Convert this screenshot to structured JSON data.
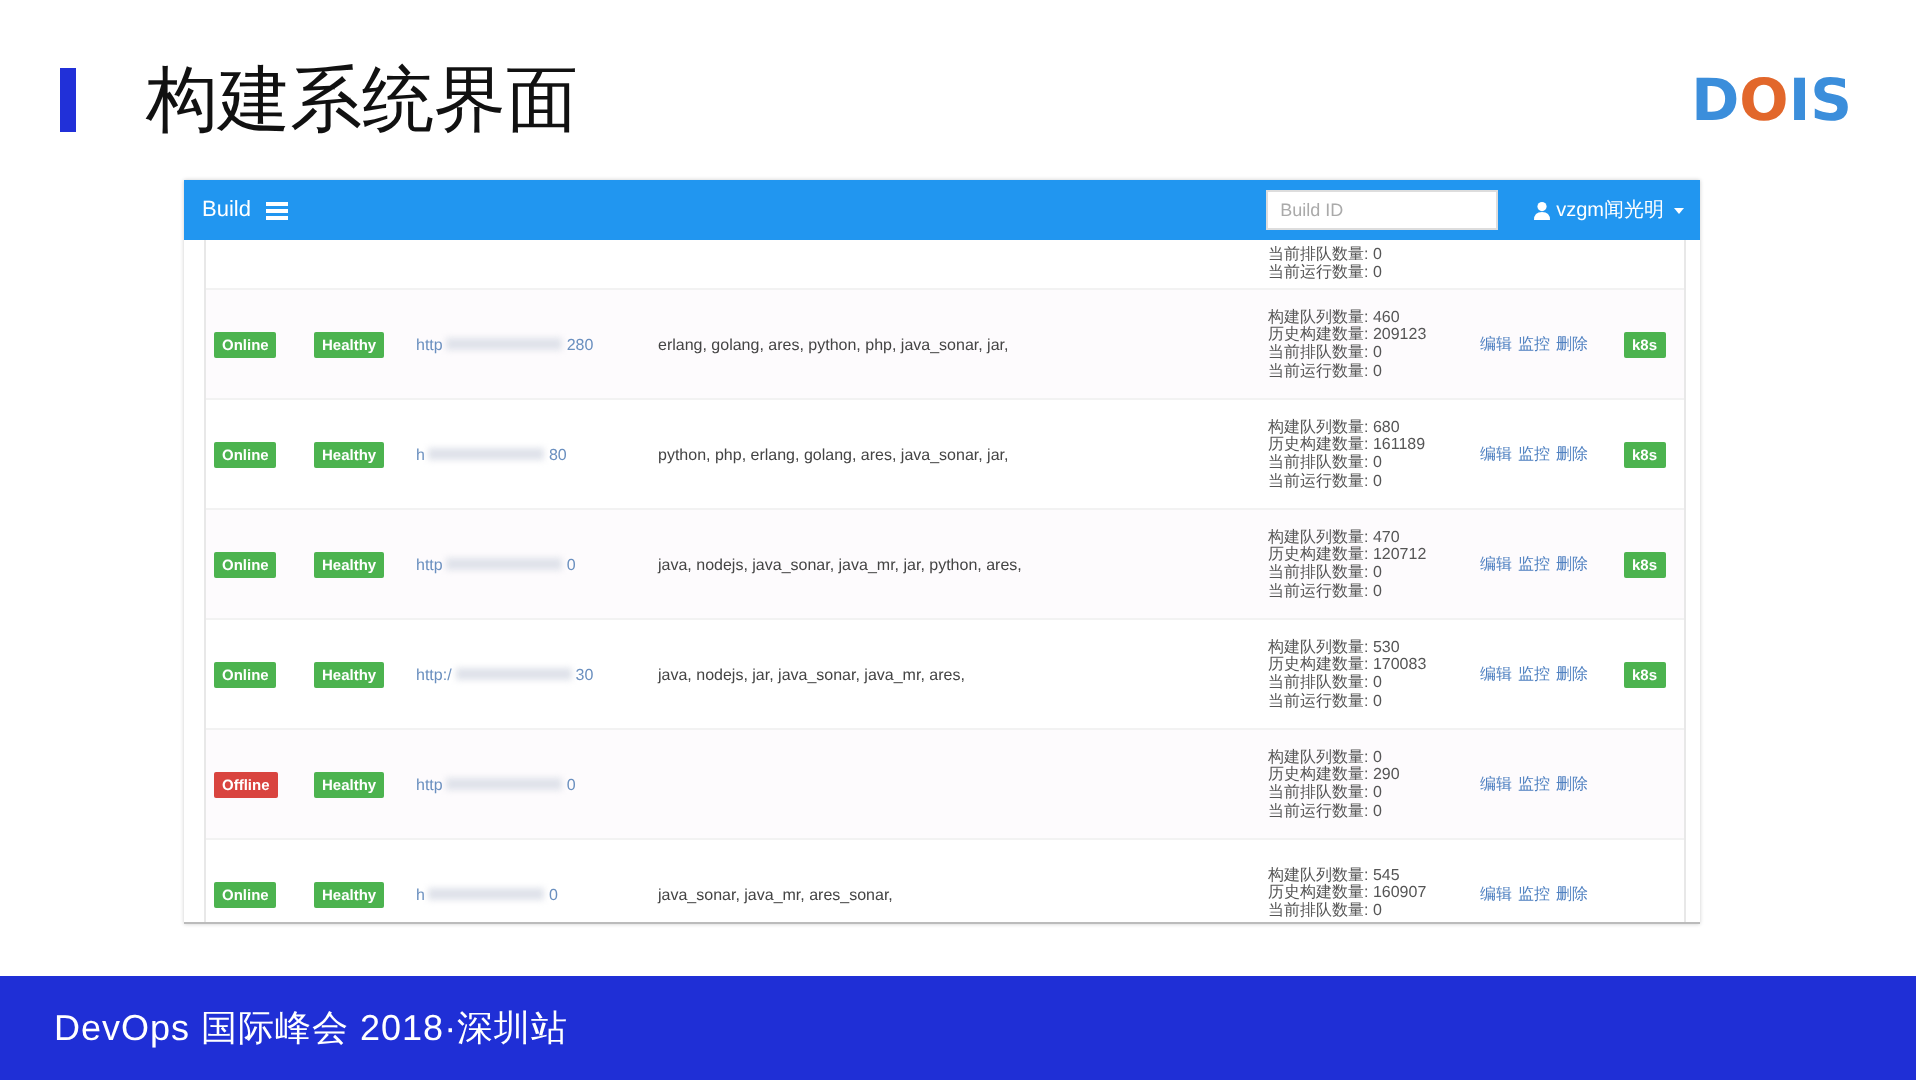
{
  "slide": {
    "title": "构建系统界面",
    "logo": [
      {
        "text": "D",
        "color": "#3b8edb"
      },
      {
        "text": "O",
        "color": "#e2672b"
      },
      {
        "text": "I",
        "color": "#3b8edb"
      },
      {
        "text": "S",
        "color": "#3b8edb"
      }
    ],
    "footer": "DevOps 国际峰会 2018·深圳站"
  },
  "app": {
    "brand": "Build",
    "search": {
      "placeholder": "Build ID"
    },
    "user": "vzgm闻光明",
    "rows": [
      {
        "stats": [
          "当前排队数量: 0",
          "当前运行数量: 0"
        ]
      },
      {
        "status": {
          "text": "Online",
          "kind": "online"
        },
        "health": {
          "text": "Healthy",
          "kind": "healthy"
        },
        "url_start": "http",
        "url_end": "280",
        "languages": "erlang, golang, ares, python, php, java_sonar, jar,",
        "stats": [
          "构建队列数量: 460",
          "历史构建数量: 209123",
          "当前排队数量: 0",
          "当前运行数量: 0"
        ],
        "actions": [
          "编辑",
          "监控",
          "删除"
        ],
        "tag": "k8s"
      },
      {
        "status": {
          "text": "Online",
          "kind": "online"
        },
        "health": {
          "text": "Healthy",
          "kind": "healthy"
        },
        "url_start": "h",
        "url_end": "80",
        "languages": "python, php, erlang, golang, ares, java_sonar, jar,",
        "stats": [
          "构建队列数量: 680",
          "历史构建数量: 161189",
          "当前排队数量: 0",
          "当前运行数量: 0"
        ],
        "actions": [
          "编辑",
          "监控",
          "删除"
        ],
        "tag": "k8s"
      },
      {
        "status": {
          "text": "Online",
          "kind": "online"
        },
        "health": {
          "text": "Healthy",
          "kind": "healthy"
        },
        "url_start": "http",
        "url_end": "0",
        "languages": "java, nodejs, java_sonar, java_mr, jar, python, ares,",
        "stats": [
          "构建队列数量: 470",
          "历史构建数量: 120712",
          "当前排队数量: 0",
          "当前运行数量: 0"
        ],
        "actions": [
          "编辑",
          "监控",
          "删除"
        ],
        "tag": "k8s"
      },
      {
        "status": {
          "text": "Online",
          "kind": "online"
        },
        "health": {
          "text": "Healthy",
          "kind": "healthy"
        },
        "url_start": "http:/",
        "url_end": "30",
        "languages": "java, nodejs, jar, java_sonar, java_mr, ares,",
        "stats": [
          "构建队列数量: 530",
          "历史构建数量: 170083",
          "当前排队数量: 0",
          "当前运行数量: 0"
        ],
        "actions": [
          "编辑",
          "监控",
          "删除"
        ],
        "tag": "k8s"
      },
      {
        "status": {
          "text": "Offline",
          "kind": "offline"
        },
        "health": {
          "text": "Healthy",
          "kind": "healthy"
        },
        "url_start": "http",
        "url_end": "0",
        "stats": [
          "构建队列数量: 0",
          "历史构建数量: 290",
          "当前排队数量: 0",
          "当前运行数量: 0"
        ],
        "actions": [
          "编辑",
          "监控",
          "删除"
        ]
      },
      {
        "status": {
          "text": "Online",
          "kind": "online"
        },
        "health": {
          "text": "Healthy",
          "kind": "healthy"
        },
        "url_start": "h",
        "url_end": "0",
        "languages": "java_sonar, java_mr, ares_sonar,",
        "stats": [
          "构建队列数量: 545",
          "历史构建数量: 160907",
          "当前排队数量: 0"
        ],
        "actions": [
          "编辑",
          "监控",
          "删除"
        ]
      }
    ]
  }
}
